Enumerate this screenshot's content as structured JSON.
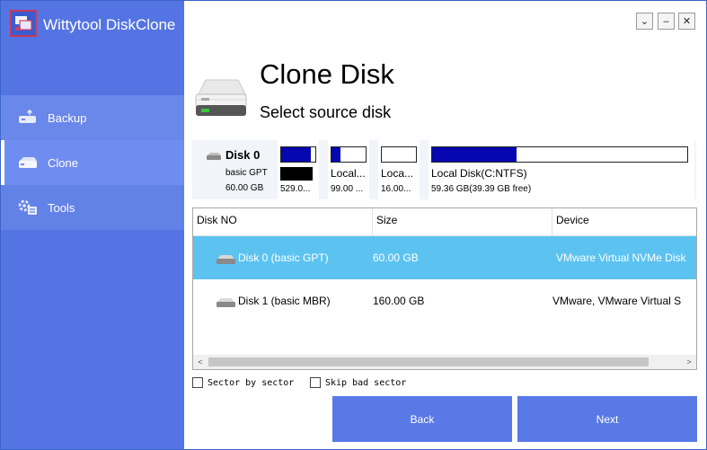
{
  "app": {
    "title": "Wittytool DiskClone",
    "logo_icon": "app-logo-icon"
  },
  "window_controls": {
    "restore": "⌄",
    "minimize": "–",
    "close": "✕"
  },
  "sidebar": {
    "items": [
      {
        "label": "Backup",
        "icon": "backup-icon",
        "selected": false
      },
      {
        "label": "Clone",
        "icon": "disk-icon",
        "selected": true
      },
      {
        "label": "Tools",
        "icon": "tools-icon",
        "selected": false
      }
    ]
  },
  "header": {
    "title": "Clone Disk",
    "subtitle": "Select source disk",
    "icon": "hard-drive-icon"
  },
  "disk_map": {
    "name": "Disk 0",
    "type": "basic GPT",
    "size": "60.00 GB",
    "partitions": [
      {
        "label": "",
        "sub": "529.0...",
        "used_fraction": 0.88,
        "hidden_label": true
      },
      {
        "label": "Local...",
        "sub": "99.00 ...",
        "used_fraction": 0.25
      },
      {
        "label": "Loca...",
        "sub": "16.00...",
        "used_fraction": 0.0
      },
      {
        "label": "Local Disk(C:NTFS)",
        "sub": "59.36 GB(39.39 GB  free)",
        "used_fraction": 0.33
      }
    ]
  },
  "disk_table": {
    "columns": [
      "Disk NO",
      "Size",
      "Device"
    ],
    "rows": [
      {
        "name": "Disk 0 (basic GPT)",
        "size": "60.00 GB",
        "device": "VMware Virtual NVMe Disk",
        "selected": true
      },
      {
        "name": "Disk 1 (basic MBR)",
        "size": "160.00 GB",
        "device": "VMware,  VMware Virtual S",
        "selected": false
      }
    ]
  },
  "scrollbar": {
    "left_arrow": "<",
    "right_arrow": ">"
  },
  "options": {
    "sector_by_sector": {
      "label": "Sector by sector",
      "checked": false
    },
    "skip_bad_sector": {
      "label": "Skip bad sector",
      "checked": false
    }
  },
  "actions": {
    "back": "Back",
    "next": "Next"
  },
  "colors": {
    "sidebar": "#5474e4",
    "selected_row": "#5cc3f1",
    "partition_fill": "#0707b0",
    "button": "#5979e6"
  }
}
